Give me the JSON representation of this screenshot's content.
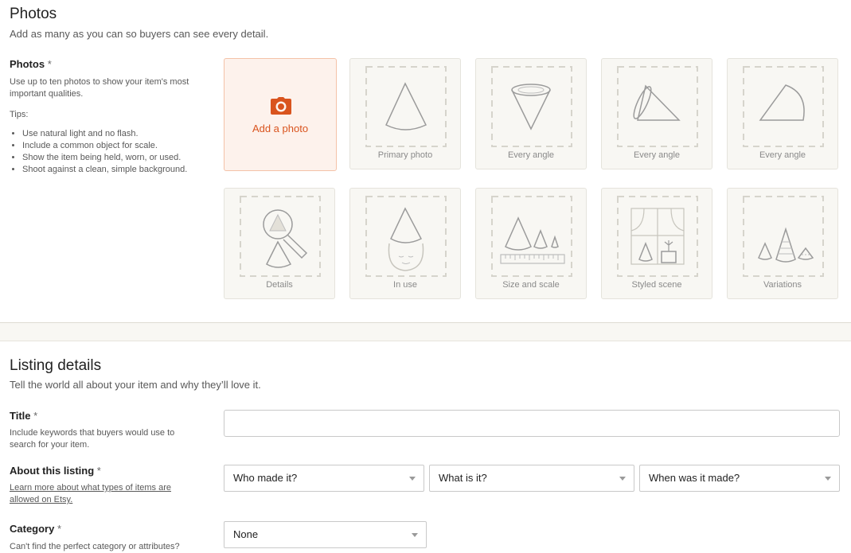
{
  "photos": {
    "title": "Photos",
    "subtitle": "Add as many as you can so buyers can see every detail.",
    "field_label": "Photos",
    "required_mark": "*",
    "help": "Use up to ten photos to show your item's most important qualities.",
    "tips_label": "Tips:",
    "tips": [
      "Use natural light and no flash.",
      "Include a common object for scale.",
      "Show the item being held, worn, or used.",
      "Shoot against a clean, simple background."
    ],
    "add_photo_label": "Add a photo",
    "slots": [
      {
        "caption": "Primary photo",
        "icon": "cone-icon"
      },
      {
        "caption": "Every angle",
        "icon": "cone-top-icon"
      },
      {
        "caption": "Every angle",
        "icon": "cone-side-icon"
      },
      {
        "caption": "Every angle",
        "icon": "cone-back-icon"
      },
      {
        "caption": "Details",
        "icon": "magnifier-icon"
      },
      {
        "caption": "In use",
        "icon": "cone-hat-icon"
      },
      {
        "caption": "Size and scale",
        "icon": "ruler-icon"
      },
      {
        "caption": "Styled scene",
        "icon": "window-scene-icon"
      },
      {
        "caption": "Variations",
        "icon": "cone-variations-icon"
      }
    ]
  },
  "listing": {
    "title": "Listing details",
    "subtitle": "Tell the world all about your item and why they’ll love it.",
    "title_field": {
      "label": "Title",
      "required_mark": "*",
      "help": "Include keywords that buyers would use to search for your item.",
      "value": "",
      "placeholder": ""
    },
    "about": {
      "label": "About this listing",
      "required_mark": "*",
      "link": "Learn more about what types of items are allowed on Etsy.",
      "selects": [
        "Who made it?",
        "What is it?",
        "When was it made?"
      ]
    },
    "category": {
      "label": "Category",
      "required_mark": "*",
      "help": "Can't find the perfect category or attributes?",
      "value": "None"
    }
  },
  "colors": {
    "accent": "#d9541e",
    "accent_bg": "#fdf2ec",
    "tile_bg": "#f8f7f3"
  }
}
